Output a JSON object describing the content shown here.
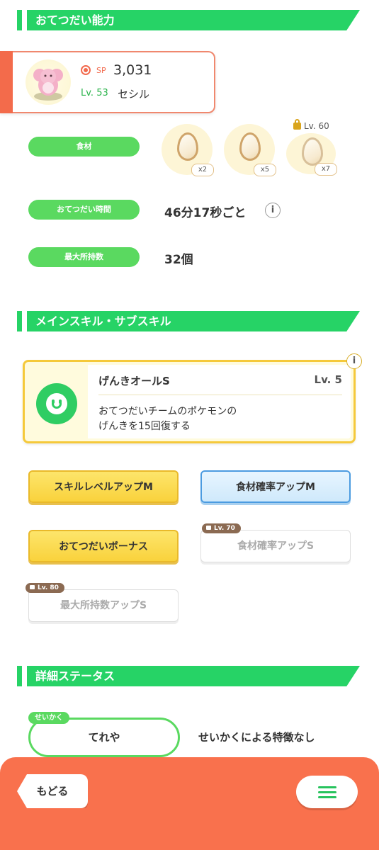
{
  "sections": {
    "ability_title": "おてつだい能力",
    "skills_title": "メインスキル・サブスキル",
    "details_title": "詳細ステータス"
  },
  "pokemon": {
    "sp_label": "SP",
    "sp_value": "3,031",
    "level": "Lv. 53",
    "name": "セシル"
  },
  "ability": {
    "ingredients_label": "食材",
    "ingredients": [
      {
        "name": "egg-icon",
        "count": "x2"
      },
      {
        "name": "egg-icon",
        "count": "x5"
      },
      {
        "name": "egg-icon",
        "count": "x7"
      }
    ],
    "ingredient_lock_level": "Lv. 60",
    "help_time_label": "おてつだい時間",
    "help_time_value": "46分17秒ごと",
    "info_glyph": "i",
    "max_carry_label": "最大所持数",
    "max_carry_value": "32個"
  },
  "main_skill": {
    "name": "げんきオールS",
    "level": "Lv. 5",
    "description": "おてつだいチームのポケモンの\nげんきを15回復する"
  },
  "sub_skills": [
    {
      "label": "スキルレベルアップM",
      "style": "gold",
      "lock": ""
    },
    {
      "label": "食材確率アップM",
      "style": "blue",
      "lock": ""
    },
    {
      "label": "おてつだいボーナス",
      "style": "gold",
      "lock": ""
    },
    {
      "label": "食材確率アップS",
      "style": "locked",
      "lock": "Lv. 70"
    },
    {
      "label": "最大所持数アップS",
      "style": "locked",
      "lock": "Lv. 80"
    }
  ],
  "nature": {
    "tag": "せいかく",
    "name": "てれや",
    "effect": "せいかくによる特徴なし"
  },
  "bottom": {
    "back_label": "もどる"
  },
  "colors": {
    "accent_green": "#26d366",
    "pill_green": "#5ad960",
    "bottom_bar": "#f9714d",
    "gold": "#f9d23c",
    "blue": "#cfe9fb"
  }
}
